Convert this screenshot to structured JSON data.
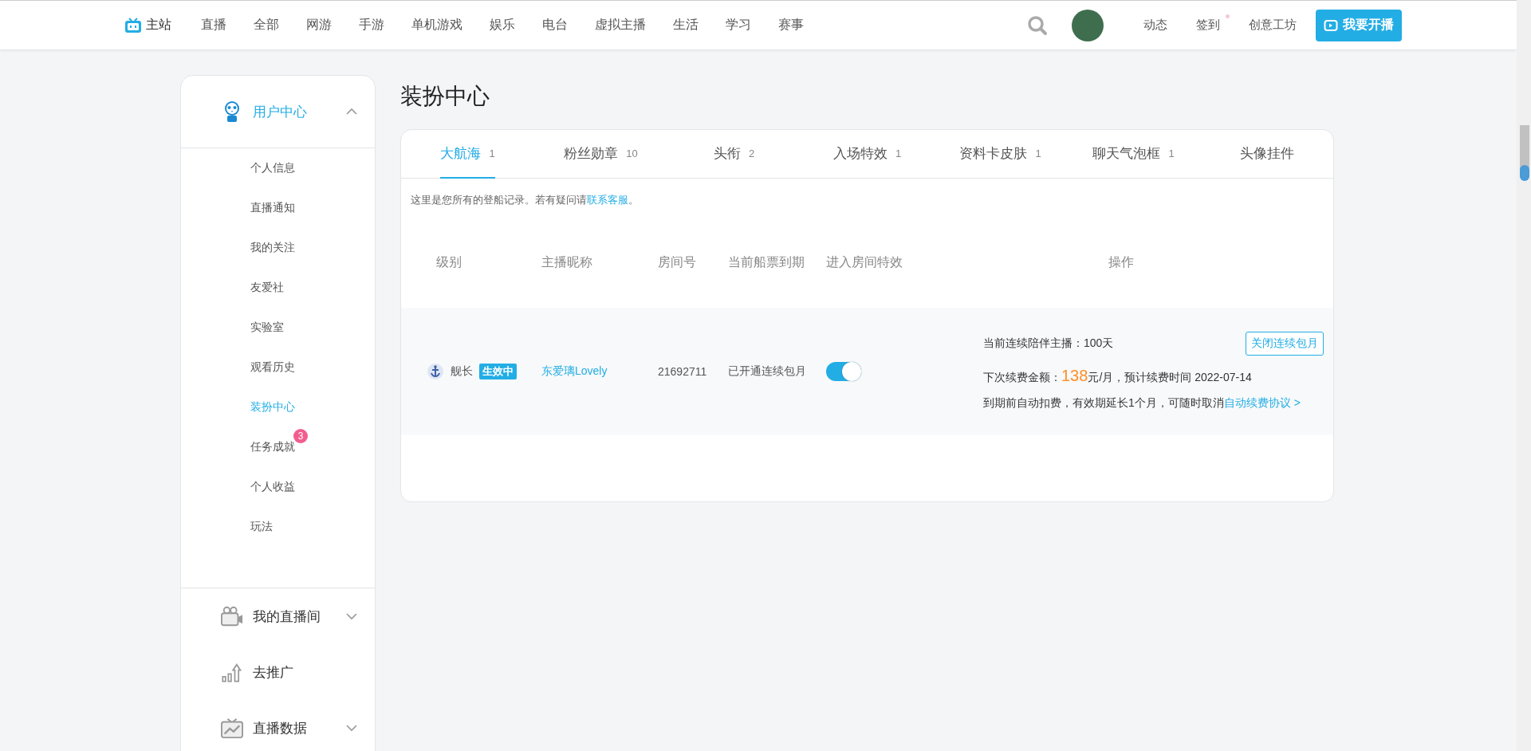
{
  "topbar": {
    "home": "主站",
    "links": [
      "直播",
      "全部",
      "网游",
      "手游",
      "单机游戏",
      "娱乐",
      "电台",
      "虚拟主播",
      "生活",
      "学习",
      "赛事"
    ],
    "right_links": [
      {
        "label": "动态",
        "dot": false
      },
      {
        "label": "签到",
        "dot": true
      },
      {
        "label": "创意工坊",
        "dot": false
      }
    ],
    "start_button": "我要开播"
  },
  "sidebar": {
    "sections": [
      {
        "kind": "group",
        "label": "用户中心",
        "expanded": true,
        "items": [
          {
            "label": "个人信息",
            "selected": false
          },
          {
            "label": "直播通知",
            "selected": false
          },
          {
            "label": "我的关注",
            "selected": false
          },
          {
            "label": "友爱社",
            "selected": false
          },
          {
            "label": "实验室",
            "selected": false
          },
          {
            "label": "观看历史",
            "selected": false
          },
          {
            "label": "装扮中心",
            "selected": true
          },
          {
            "label": "任务成就",
            "selected": false,
            "badge": "3"
          },
          {
            "label": "个人收益",
            "selected": false
          },
          {
            "label": "玩法",
            "selected": false
          }
        ]
      },
      {
        "kind": "group",
        "label": "我的直播间",
        "expanded": false
      },
      {
        "kind": "link",
        "label": "去推广"
      },
      {
        "kind": "group",
        "label": "直播数据",
        "expanded": false
      }
    ]
  },
  "page_title": "装扮中心",
  "tabs": [
    {
      "label": "大航海",
      "count": "1",
      "selected": true
    },
    {
      "label": "粉丝勋章",
      "count": "10",
      "selected": false
    },
    {
      "label": "头衔",
      "count": "2",
      "selected": false
    },
    {
      "label": "入场特效",
      "count": "1",
      "selected": false
    },
    {
      "label": "资料卡皮肤",
      "count": "1",
      "selected": false
    },
    {
      "label": "聊天气泡框",
      "count": "1",
      "selected": false
    },
    {
      "label": "头像挂件",
      "selected": false
    }
  ],
  "notice": {
    "text": "这里是您所有的登船记录。若有疑问请",
    "link": "联系客服",
    "end": "。"
  },
  "table": {
    "columns": [
      "级别",
      "主播昵称",
      "房间号",
      "当前船票到期",
      "进入房间特效",
      "操作"
    ],
    "rows": [
      {
        "level": "舰长",
        "status": "生效中",
        "streamer": "东爱璃Lovely",
        "room": "21692711",
        "expiry": "已开通连续包月",
        "effect_on": true,
        "streak": "当前连续陪伴主播：100天",
        "cancel_button": "关闭连续包月",
        "next_label": "下次续费金额：",
        "amount": "138",
        "next_rest": "元/月，预计续费时间 2022-07-14",
        "auto_text": "到期前自动扣费，有效期延长1个月，可随时取消",
        "auto_link": "自动续费协议 >"
      }
    ]
  }
}
